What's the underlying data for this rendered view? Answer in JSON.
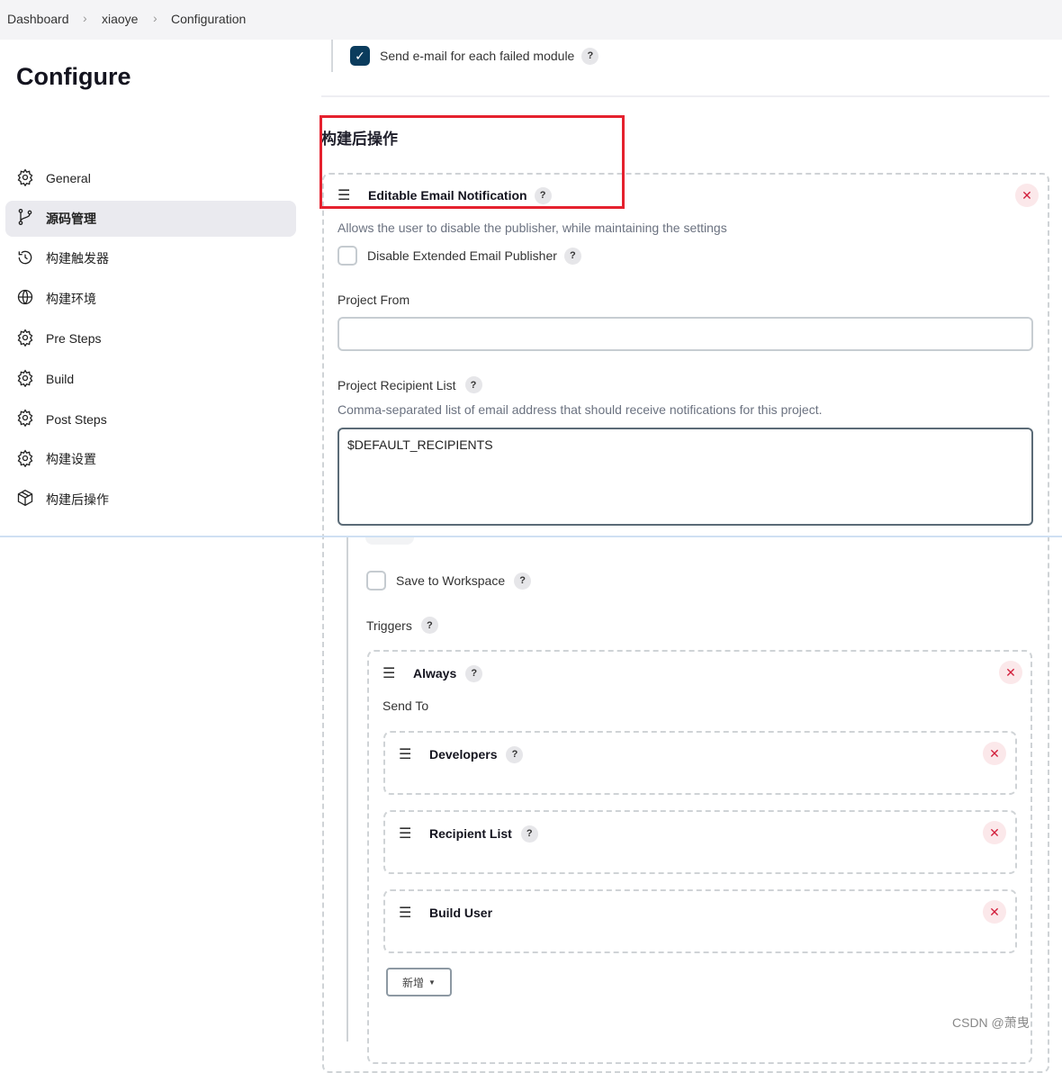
{
  "breadcrumb": [
    "Dashboard",
    "xiaoye",
    "Configuration"
  ],
  "sidebar": {
    "title": "Configure",
    "items": [
      {
        "label": "General",
        "icon": "gear-icon"
      },
      {
        "label": "源码管理",
        "icon": "branch-icon",
        "active": true
      },
      {
        "label": "构建触发器",
        "icon": "clock-icon"
      },
      {
        "label": "构建环境",
        "icon": "globe-icon"
      },
      {
        "label": "Pre Steps",
        "icon": "gear-icon"
      },
      {
        "label": "Build",
        "icon": "gear-icon"
      },
      {
        "label": "Post Steps",
        "icon": "gear-icon"
      },
      {
        "label": "构建设置",
        "icon": "gear-icon"
      },
      {
        "label": "构建后操作",
        "icon": "package-icon"
      }
    ]
  },
  "main": {
    "send_each_failed": "Send e-mail for each failed module",
    "section_title": "构建后操作",
    "publisher_title": "Editable Email Notification",
    "publisher_desc": "Allows the user to disable the publisher, while maintaining the settings",
    "disable_label": "Disable Extended Email Publisher",
    "project_from_label": "Project From",
    "project_from_value": "",
    "recipient_label": "Project Recipient List",
    "recipient_desc": "Comma-separated list of email address that should receive notifications for this project.",
    "recipient_value": "$DEFAULT_RECIPIENTS",
    "save_workspace": "Save to Workspace",
    "triggers_label": "Triggers",
    "trigger": "Always",
    "send_to": "Send To",
    "recipients": [
      "Developers",
      "Recipient List",
      "Build User"
    ],
    "add_button": "新增"
  },
  "help": "?",
  "watermark": "CSDN @萧曳",
  "colors": {
    "accent": "#0b3c5d",
    "highlight": "#e5212e",
    "danger": "#d21f3c"
  }
}
